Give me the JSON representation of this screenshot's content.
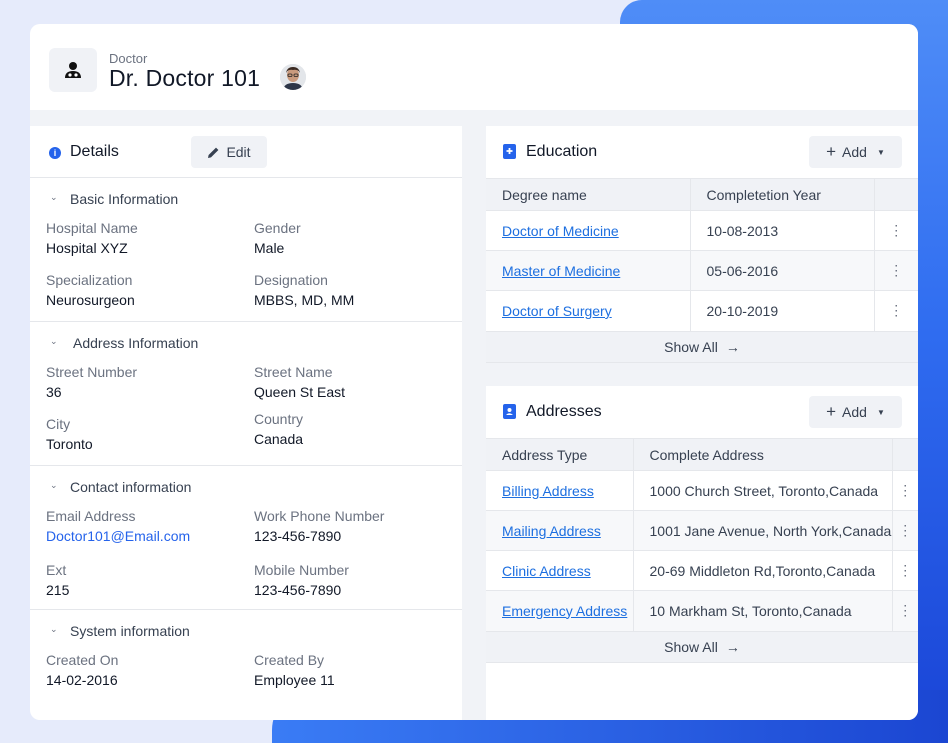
{
  "header": {
    "subtitle": "Doctor",
    "title": "Dr. Doctor 101"
  },
  "details": {
    "title": "Details",
    "edit_label": "Edit",
    "sections": {
      "basic": {
        "title": "Basic Information",
        "hospital_label": "Hospital Name",
        "hospital_value": "Hospital XYZ",
        "gender_label": "Gender",
        "gender_value": "Male",
        "specialization_label": "Specialization",
        "specialization_value": "Neurosurgeon",
        "designation_label": "Designation",
        "designation_value": "MBBS, MD, MM"
      },
      "address": {
        "title": "Address Information",
        "street_number_label": "Street Number",
        "street_number_value": "36",
        "street_name_label": "Street Name",
        "street_name_value": "Queen St East",
        "city_label": "City",
        "city_value": "Toronto",
        "country_label": "Country",
        "country_value": "Canada"
      },
      "contact": {
        "title": "Contact information",
        "email_label": "Email Address",
        "email_value": "Doctor101@Email.com",
        "work_phone_label": "Work Phone Number",
        "work_phone_value": "123-456-7890",
        "ext_label": "Ext",
        "ext_value": "215",
        "mobile_label": "Mobile Number",
        "mobile_value": "123-456-7890"
      },
      "system": {
        "title": "System information",
        "created_on_label": "Created On",
        "created_on_value": "14-02-2016",
        "created_by_label": "Created By",
        "created_by_value": "Employee 11"
      }
    }
  },
  "education": {
    "title": "Education",
    "add_label": "Add",
    "columns": [
      "Degree name",
      "Completetion Year"
    ],
    "rows": [
      {
        "degree": "Doctor of Medicine",
        "year": "10-08-2013"
      },
      {
        "degree": "Master of Medicine",
        "year": "05-06-2016"
      },
      {
        "degree": "Doctor of Surgery",
        "year": "20-10-2019"
      }
    ],
    "show_all": "Show All"
  },
  "addresses": {
    "title": "Addresses",
    "add_label": "Add",
    "columns": [
      "Address Type",
      "Complete Address"
    ],
    "rows": [
      {
        "type": "Billing Address",
        "address": "1000 Church Street, Toronto,Canada"
      },
      {
        "type": "Mailing Address",
        "address": "1001 Jane Avenue, North York,Canada"
      },
      {
        "type": "Clinic Address",
        "address": "20-69 Middleton Rd,Toronto,Canada"
      },
      {
        "type": "Emergency Address",
        "address": "10 Markham St, Toronto,Canada"
      }
    ],
    "show_all": "Show All"
  },
  "colors": {
    "accent": "#2563eb",
    "link": "#1d6fe0",
    "background_gradient_start": "#4f8df7",
    "background_gradient_end": "#1943d6"
  },
  "icons": {
    "header": "doctor-icon",
    "details": "info-icon",
    "edit": "pencil-icon",
    "add": "plus-icon",
    "dropdown": "caret-down-icon",
    "row_menu": "kebab-icon",
    "show_all": "arrow-right-icon"
  }
}
